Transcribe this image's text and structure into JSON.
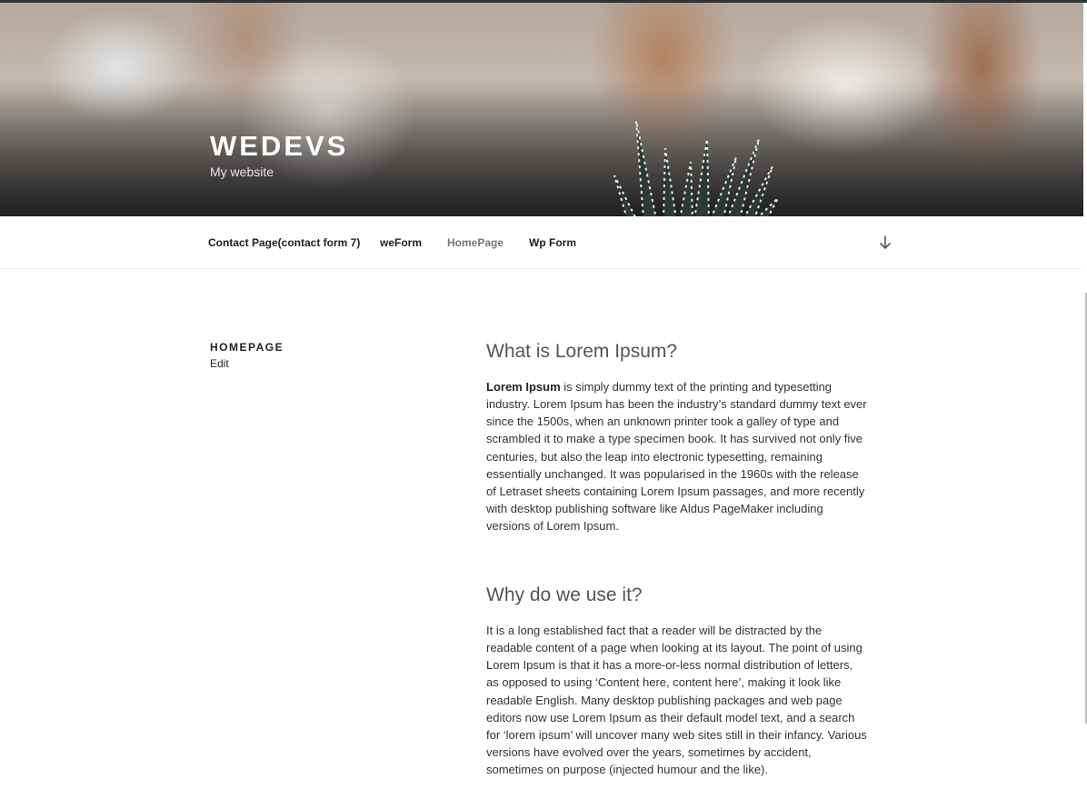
{
  "site": {
    "title": "WEDEVS",
    "description": "My website"
  },
  "nav": {
    "items": [
      {
        "label": "Contact Page(contact form 7)"
      },
      {
        "label": "weForm"
      },
      {
        "label": "HomePage",
        "current": true
      },
      {
        "label": "Wp Form"
      }
    ],
    "scroll_icon": "arrow-down-icon"
  },
  "page": {
    "title": "HOMEPAGE",
    "edit_label": "Edit"
  },
  "content": {
    "section1": {
      "heading": "What is Lorem Ipsum?",
      "strong": "Lorem Ipsum",
      "body": " is simply dummy text of the printing and typesetting industry. Lorem Ipsum has been the industry’s standard dummy text ever since the 1500s, when an unknown printer took a galley of type and scrambled it to make a type specimen book. It has survived not only five centuries, but also the leap into electronic typesetting, remaining essentially unchanged. It was popularised in the 1960s with the release of Letraset sheets containing Lorem Ipsum passages, and more recently with desktop publishing software like Aldus PageMaker including versions of Lorem Ipsum."
    },
    "section2": {
      "heading": "Why do we use it?",
      "body": "It is a long established fact that a reader will be distracted by the readable content of a page when looking at its layout. The point of using Lorem Ipsum is that it has a more-or-less normal distribution of letters, as opposed to using ‘Content here, content here’, making it look like readable English. Many desktop publishing packages and web page editors now use Lorem Ipsum as their default model text, and a search for ‘lorem ipsum’ will uncover many web sites still in their infancy. Various versions have evolved over the years, sometimes by accident, sometimes on purpose (injected humour and the like)."
    }
  }
}
